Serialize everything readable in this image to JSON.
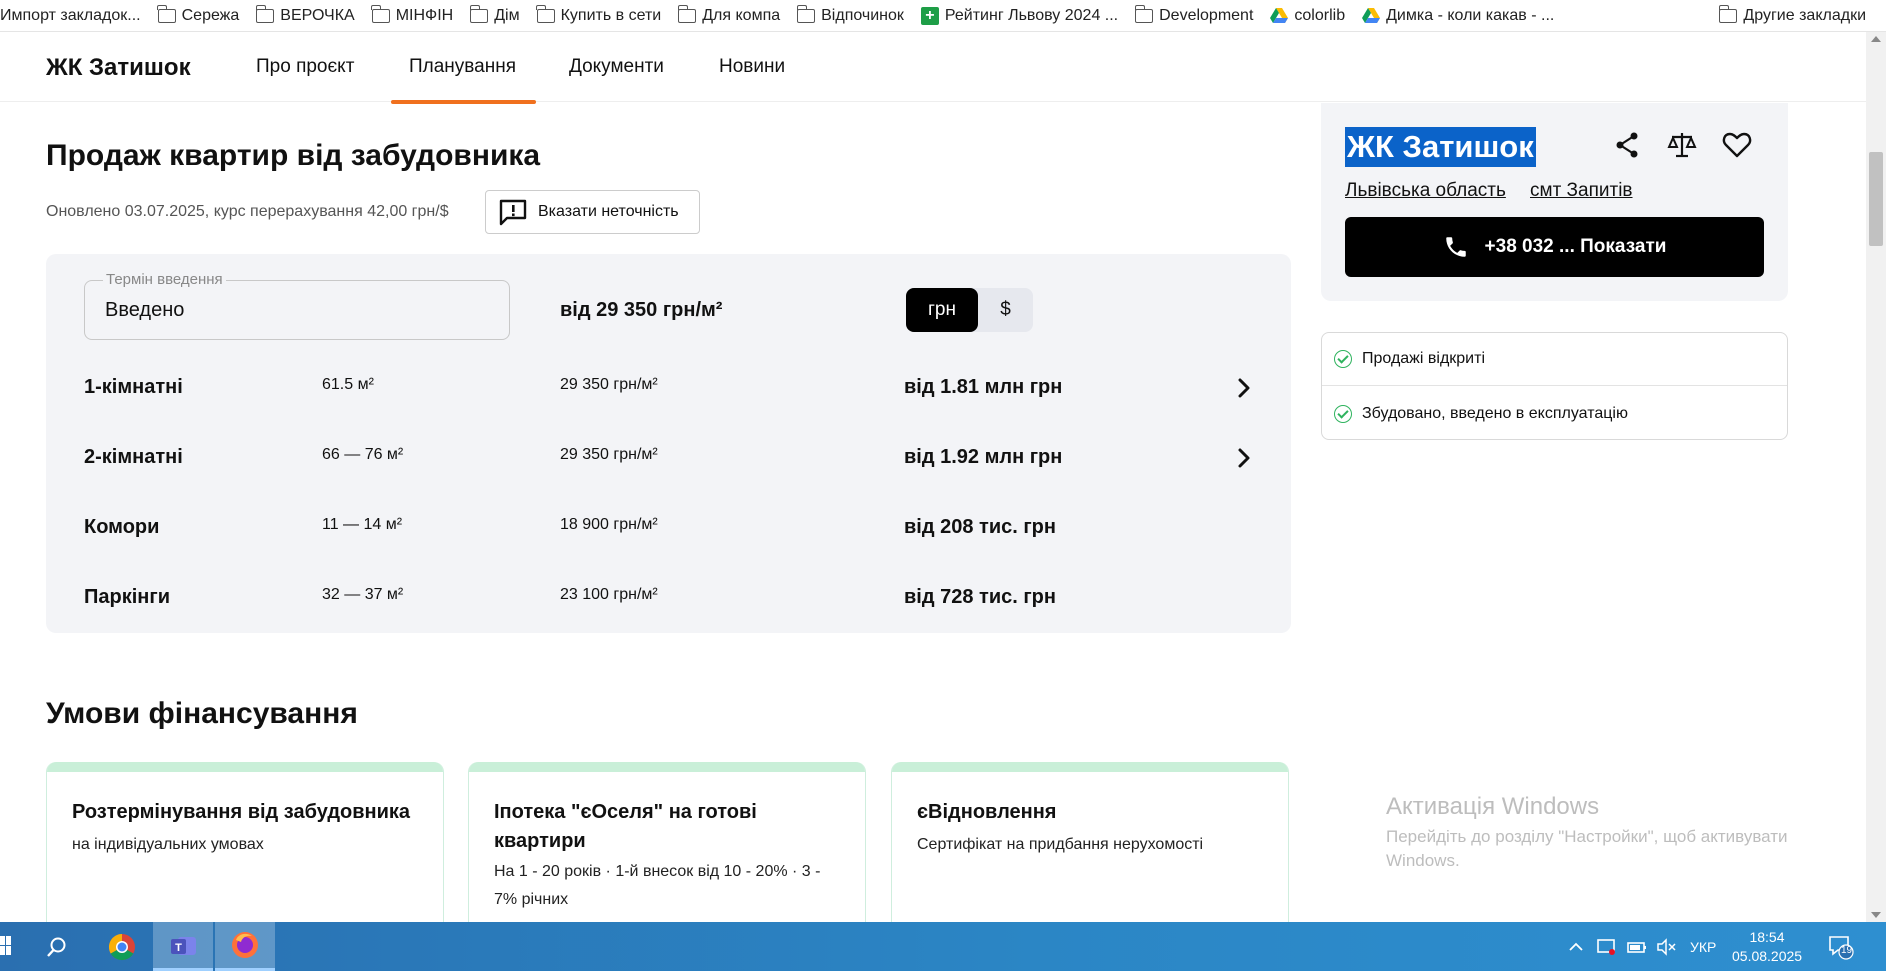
{
  "bookmarks": [
    {
      "label": "Импорт закладок...",
      "icon": "folder-icon"
    },
    {
      "label": "Сережа",
      "icon": "folder-icon"
    },
    {
      "label": "ВЕРОЧКА",
      "icon": "folder-icon"
    },
    {
      "label": "МІНФІН",
      "icon": "folder-icon"
    },
    {
      "label": "Дім",
      "icon": "folder-icon"
    },
    {
      "label": "Купить в сети",
      "icon": "folder-icon"
    },
    {
      "label": "Для компа",
      "icon": "folder-icon"
    },
    {
      "label": "Відпочинок",
      "icon": "folder-icon"
    },
    {
      "label": "Рейтинг Львову 2024 ...",
      "icon": "green-plus-icon"
    },
    {
      "label": "Development",
      "icon": "folder-icon"
    },
    {
      "label": "colorlib",
      "icon": "google-drive-icon"
    },
    {
      "label": "Димка - коли какав - ...",
      "icon": "google-drive-icon"
    }
  ],
  "other_bookmarks": "Другие закладки",
  "nav": {
    "logo": "ЖК Затишок",
    "items": [
      "Про проєкт",
      "Планування",
      "Документи",
      "Новини"
    ],
    "active": "Планування",
    "accent_color": "#f0701e"
  },
  "main": {
    "title": "Продаж квартир від забудовника",
    "updated": "Оновлено 03.07.2025, курс перерахування 42,00 грн/$",
    "report_button": "Вказати неточність"
  },
  "panel": {
    "field_legend": "Термін введення",
    "field_value": "Введено",
    "from_price": "від 29 350 грн/м²",
    "currency_options": [
      "грн",
      "$"
    ],
    "currency_selected": "грн",
    "rows": [
      {
        "category": "1-кімнатні",
        "area": "61.5 м²",
        "price_per_m2": "29 350 грн/м²",
        "total": "від 1.81 млн грн",
        "has_arrow": true
      },
      {
        "category": "2-кімнатні",
        "area": "66 — 76 м²",
        "price_per_m2": "29 350 грн/м²",
        "total": "від 1.92 млн грн",
        "has_arrow": true
      },
      {
        "category": "Комори",
        "area": "11 — 14 м²",
        "price_per_m2": "18 900 грн/м²",
        "total": "від 208 тис. грн",
        "has_arrow": false
      },
      {
        "category": "Паркінги",
        "area": "32 — 37 м²",
        "price_per_m2": "23 100 грн/м²",
        "total": "від 728 тис. грн",
        "has_arrow": false
      }
    ]
  },
  "financing": {
    "title": "Умови фінансування",
    "cards": [
      {
        "title": "Розтермінування від забудовника",
        "subtitle": "на індивідуальних умовах"
      },
      {
        "title": "Іпотека \"єОселя\" на готові квартири",
        "subtitle": "На 1 - 20 років · 1-й внесок від 10 - 20% · 3 - 7% річних"
      },
      {
        "title": "єВідновлення",
        "subtitle": "Сертифікат на придбання нерухомості"
      }
    ]
  },
  "sidebar": {
    "title": "ЖК Затишок",
    "region": "Львівська область",
    "town": "смт Запитів",
    "phone_button": "+38 032 ... Показати",
    "statuses": [
      "Продажі відкриті",
      "Збудовано, введено в експлуатацію"
    ],
    "status_color": "#2fb35e"
  },
  "watermark": {
    "title": "Активація Windows",
    "subtitle": "Перейдіть до розділу \"Настройки\", щоб активувати Windows."
  },
  "taskbar": {
    "language": "УКР",
    "time": "18:54",
    "date": "05.08.2025",
    "notification_count": "19"
  }
}
